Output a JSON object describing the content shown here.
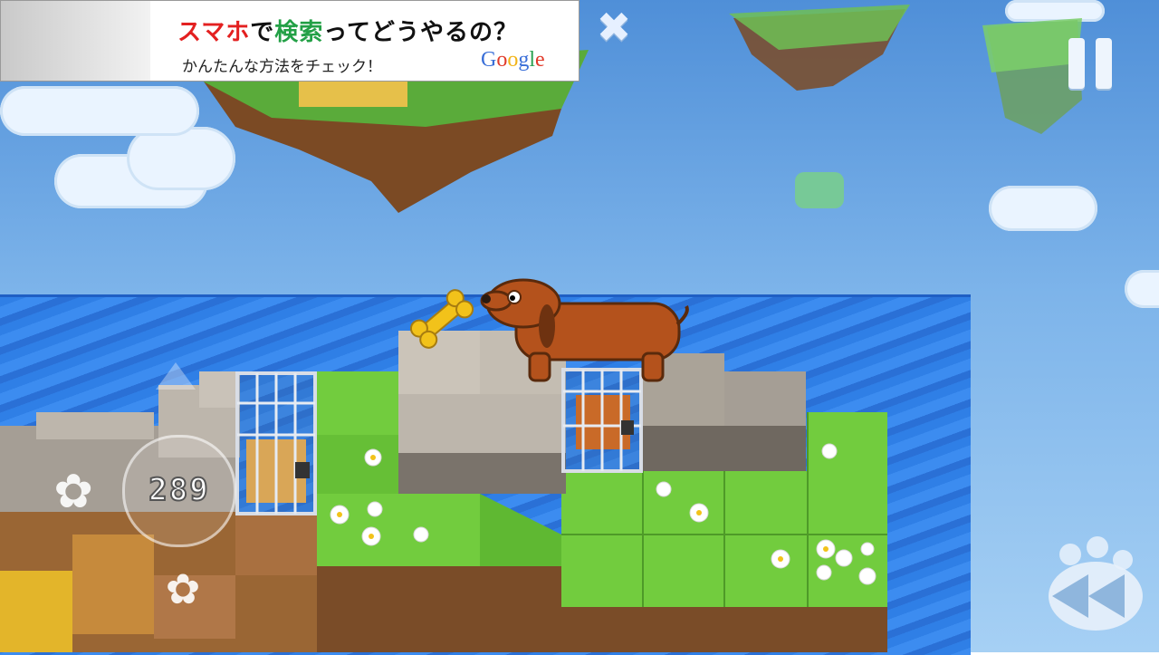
{
  "ad": {
    "line1_a": "スマホ",
    "line1_b": "で",
    "line1_c": "検索",
    "line1_d": "ってどうやるの？",
    "line2": "かんたんな方法をチェック！",
    "brand": [
      "G",
      "o",
      "o",
      "g",
      "l",
      "e"
    ],
    "close_glyph": "✖"
  },
  "hud": {
    "counter": "289",
    "pause_icon": "pause-icon",
    "rewind_icon": "rewind-icon"
  },
  "colors": {
    "sky": "#7db4ea",
    "sea": "#2f7fe6",
    "grass": "#6cc83c",
    "stone": "#b9b2a8",
    "dirt": "#8a5a2e",
    "dog": "#b4521c",
    "bone": "#f2c21a"
  }
}
